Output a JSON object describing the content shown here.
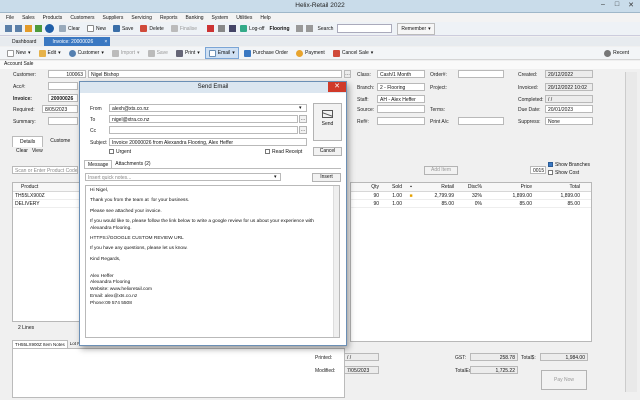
{
  "window": {
    "title": "Helix-Retail 2022"
  },
  "menu": [
    "File",
    "Sales",
    "Products",
    "Customers",
    "Suppliers",
    "Servicing",
    "Reports",
    "Banking",
    "System",
    "Utilities",
    "Help"
  ],
  "toolbar": {
    "clear": "Clear",
    "new": "New",
    "save": "Save",
    "delete": "Delete",
    "finalise": "Finalise",
    "logoff": "Log-off",
    "location": "Flooring",
    "search_label": "Search",
    "remember": "Remember"
  },
  "tabs": [
    "Dashboard",
    "Invoice: 20000026"
  ],
  "toolbar2": {
    "new": "New",
    "edit": "Edit",
    "customer": "Customer",
    "import": "Import",
    "save": "Save",
    "print": "Print",
    "email": "Email",
    "purchase_order": "Purchase Order",
    "payment": "Payment",
    "cancel_sale": "Cancel Sale",
    "recent": "Recent"
  },
  "section_title": "Account Sale",
  "form": {
    "customer_label": "Customer:",
    "customer_code": "100063",
    "customer_name": "Nigel Bishop",
    "acc_label": "Acc#:",
    "invoice_label": "Invoice:",
    "invoice_no": "20000026",
    "required_label": "Required:",
    "required_date": "8/05/2023",
    "summary_label": "Summary:",
    "class_label": "Class:",
    "class_value": "Cash/1 Month",
    "branch_label": "Branch:",
    "branch_value": "2 - Flooring",
    "staff_label": "Staff:",
    "staff_value": "AH - Alex Heffer",
    "source_label": "Source:",
    "ref_label": "Ref#:",
    "order_label": "Order#:",
    "project_label": "Project:",
    "terms_label": "Terms:",
    "printac_label": "Print A/c",
    "created_label": "Created:",
    "created_value": "20/12/2022",
    "invoiced_label": "Invoiced:",
    "invoiced_value": "20/12/2022 10:02",
    "completed_label": "Completed:",
    "completed_value": "/ /",
    "due_label": "Due Date:",
    "due_value": "20/01/2023",
    "suppress_label": "Suppress:",
    "suppress_value": "None"
  },
  "detail_tabs": [
    "Details",
    "Custome"
  ],
  "detail_tools": {
    "clear": "Clear",
    "view": "View"
  },
  "scan_placeholder": "Scan or Enter Product Code",
  "add_item": "Add Item",
  "qty_box": "0015",
  "show_branches": "Show Branches",
  "show_cost": "Show Cost",
  "left_table": {
    "headers": [
      "Product"
    ],
    "rows": [
      [
        "TH55LX900Z"
      ],
      [
        "DELIVERY"
      ]
    ]
  },
  "right_table": {
    "headers": [
      "Qty",
      "Sold",
      "Retail",
      "Disc%",
      "Price",
      "Total"
    ],
    "rows": [
      [
        "90",
        "1.00",
        "2,799.99",
        "32%",
        "1,899.00",
        "1,899.00"
      ],
      [
        "90",
        "1.00",
        "85.00",
        "0%",
        "85.00",
        "85.00"
      ]
    ]
  },
  "lines_count": "2 Lines",
  "bottom_tab": "TH55LX900Z Item Notes",
  "bottom_tab2": "Lot Notes",
  "footer": {
    "printed_label": "Printed:",
    "printed_value": "/ /",
    "modified_label": "Modified:",
    "modified_value": "7/05/2023",
    "gst_label": "GST:",
    "gst_value": "258.78",
    "totalex_label": "TotalEx:",
    "totalex_value": "1,725.22",
    "total_label": "Total$:",
    "total_value": "1,984.00",
    "pay_now": "Pay Now"
  },
  "email_dialog": {
    "title": "Send Email",
    "from_label": "From",
    "from_value": "alexh@xts.co.nz",
    "to_label": "To",
    "to_value": "nigel@xtra.co.nz",
    "cc_label": "Cc",
    "cc_value": "",
    "subject_label": "Subject",
    "subject_value": "Invoice 20000026 from Alexandra Flooring, Alex Heffer",
    "send": "Send",
    "cancel": "Cancel",
    "urgent": "Urgent",
    "read_receipt": "Read Receipt",
    "tabs": [
      "Message",
      "Attachments (2)"
    ],
    "quick_notes_placeholder": "Insert quick notes...",
    "insert": "Insert",
    "body": [
      "Hi Nigel,",
      "Thank you from the team at  for your business.",
      "Please see attached your invoice.",
      "If you would like to, please follow the link below to write a google review for us about your experience with Alexandra Flooring.",
      "HTTPS://GOOGLE CUSTOM REVIEW URL",
      "If you have any questions, please let us know.",
      "Kind Regards,",
      "\nAlex Heffer\nAlexandra Flooring\nWebsite: www.helixretail.com\nEmail: alex@xts.co.nz\nPhone:09 574 5508"
    ]
  },
  "colors": {
    "accent": "#3a78c2",
    "title_bg": "#c9dcea",
    "close_red": "#d03a2a"
  }
}
